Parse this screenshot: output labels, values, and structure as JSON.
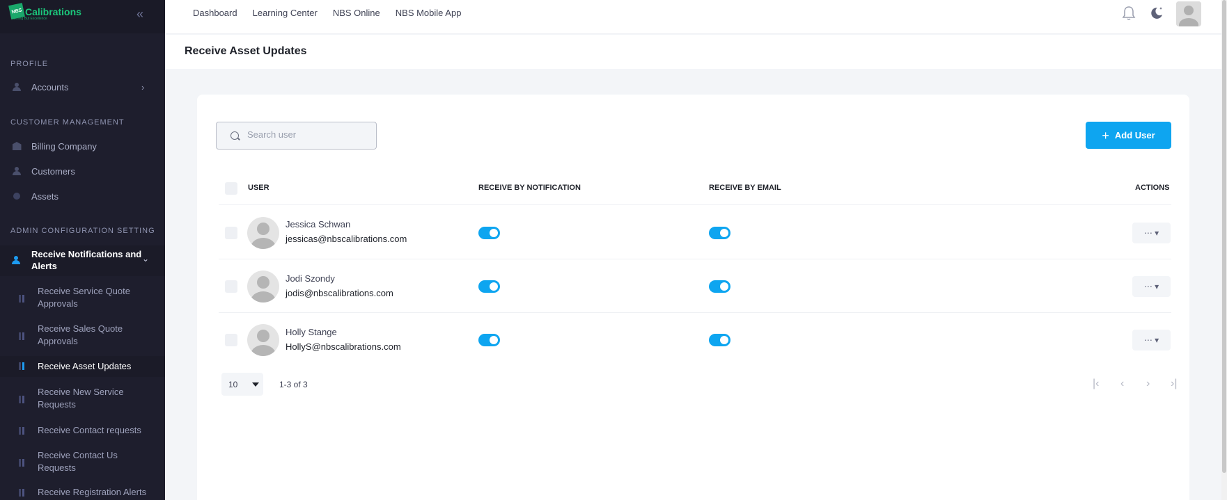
{
  "brand": {
    "badge": "NBS",
    "name": "Calibrations",
    "tagline": "Nothing But Excellence"
  },
  "sidebar": {
    "collapse_icon": "double-chevron-left-icon",
    "sections": {
      "profile": "PROFILE",
      "customer_management": "CUSTOMER MANAGEMENT",
      "admin_config": "ADMIN CONFIGURATION SETTING"
    },
    "accounts": "Accounts",
    "billing_company": "Billing Company",
    "customers": "Customers",
    "assets": "Assets",
    "receive_notifications_line1": "Receive Notifications and",
    "receive_notifications_line2": "Alerts",
    "sub_items": [
      {
        "line1": "Receive Service Quote",
        "line2": "Approvals"
      },
      {
        "line1": "Receive Sales Quote",
        "line2": "Approvals"
      },
      {
        "line1": "Receive Asset Updates",
        "line2": ""
      },
      {
        "line1": "Receive New Service",
        "line2": "Requests"
      },
      {
        "line1": "Receive Contact requests",
        "line2": ""
      },
      {
        "line1": "Receive Contact Us",
        "line2": "Requests"
      },
      {
        "line1": "Receive Registration Alerts",
        "line2": ""
      }
    ]
  },
  "topnav": {
    "items": [
      "Dashboard",
      "Learning Center",
      "NBS Online",
      "NBS Mobile App"
    ]
  },
  "page": {
    "title": "Receive Asset Updates"
  },
  "search": {
    "placeholder": "Search user",
    "value": ""
  },
  "add_user": {
    "label": "Add User"
  },
  "table": {
    "headers": {
      "user": "USER",
      "notification": "RECEIVE BY NOTIFICATION",
      "email": "RECEIVE BY EMAIL",
      "actions": "ACTIONS"
    },
    "rows": [
      {
        "name": "Jessica Schwan",
        "email": "jessicas@nbscalibrations.com",
        "by_notification": true,
        "by_email": true,
        "actions": "⋯ ▾"
      },
      {
        "name": "Jodi Szondy",
        "email": "jodis@nbscalibrations.com",
        "by_notification": true,
        "by_email": true,
        "actions": "⋯ ▾"
      },
      {
        "name": "Holly Stange",
        "email": "HollyS@nbscalibrations.com",
        "by_notification": true,
        "by_email": true,
        "actions": "⋯ ▾"
      }
    ]
  },
  "pagination": {
    "page_size": "10",
    "info": "1-3 of 3",
    "first": "|‹",
    "prev": "‹",
    "next": "›",
    "last": "›|"
  },
  "colors": {
    "accent": "#0ea5f0",
    "sidebar_bg": "#1e1e2d"
  }
}
